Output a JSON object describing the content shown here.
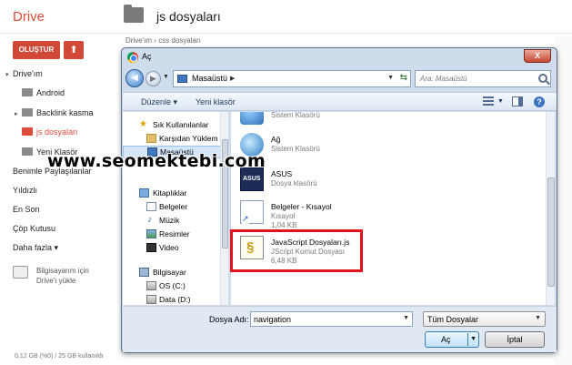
{
  "drive": {
    "logo": "Drive",
    "folder_title": "js dosyaları",
    "create_label": "OLUŞTUR",
    "upload_icon": "upload-icon",
    "breadcrumb": "Drive'ım  ›  css dosyaları",
    "nav": [
      {
        "label": "Drive'ım",
        "type": "root"
      },
      {
        "label": "Android",
        "type": "folder"
      },
      {
        "label": "Backlink kasma",
        "type": "folder-expandable"
      },
      {
        "label": "js dosyaları",
        "type": "folder-active"
      },
      {
        "label": "Yeni Klasör",
        "type": "folder"
      },
      {
        "label": "Benimle Paylaşılanlar",
        "type": "link"
      },
      {
        "label": "Yıldızlı",
        "type": "link"
      },
      {
        "label": "En Son",
        "type": "link"
      },
      {
        "label": "Çöp Kutusu",
        "type": "link"
      },
      {
        "label": "Daha fazla",
        "type": "link-dropdown"
      }
    ],
    "pc_sync_line1": "Bilgisayarım için",
    "pc_sync_line2": "Drive'ı yükle",
    "storage": "0,12 GB (%0) / 25 GB kullanıldı",
    "active_color": "#dd4b39"
  },
  "dialog": {
    "title": "Aç",
    "close_label": "X",
    "address": "Masaüstü",
    "search_placeholder": "Ara: Masaüstü",
    "toolbar": {
      "organize": "Düzenle",
      "new_folder": "Yeni klasör"
    },
    "sidebar": [
      {
        "label": "Sık Kullanılanlar",
        "icon": "star-icon"
      },
      {
        "label": "Karşıdan Yüklem",
        "icon": "folder-icon"
      },
      {
        "label": "Masaüstü",
        "icon": "desktop-icon",
        "selected": true
      },
      {
        "label": "Kitaplıklar",
        "icon": "library-icon"
      },
      {
        "label": "Belgeler",
        "icon": "document-icon"
      },
      {
        "label": "Müzik",
        "icon": "music-icon"
      },
      {
        "label": "Resimler",
        "icon": "picture-icon"
      },
      {
        "label": "Video",
        "icon": "video-icon"
      },
      {
        "label": "Bilgisayar",
        "icon": "computer-icon"
      },
      {
        "label": "OS (C:)",
        "icon": "drive-icon"
      },
      {
        "label": "Data (D:)",
        "icon": "drive-icon"
      }
    ],
    "files": [
      {
        "name": "",
        "type": "Sistem Klasörü",
        "size": "",
        "icon": "system-folder-icon"
      },
      {
        "name": "Ağ",
        "type": "Sistem Klasörü",
        "size": "",
        "icon": "network-icon"
      },
      {
        "name": "ASUS",
        "type": "Dosya klasörü",
        "size": "",
        "icon": "asus-folder-icon"
      },
      {
        "name": "Belgeler - Kısayol",
        "type": "Kısayol",
        "size": "1,04 KB",
        "icon": "shortcut-icon"
      },
      {
        "name": "JavaScript Dosyaları.js",
        "type": "JScript Komut Dosyası",
        "size": "6,48 KB",
        "icon": "jscript-file-icon"
      }
    ],
    "filename_label": "Dosya Adı:",
    "filename_value": "navigation",
    "filetype_value": "Tüm Dosyalar",
    "open_label": "Aç",
    "cancel_label": "İptal",
    "highlight_color": "#e0141e"
  },
  "watermark": "www.seomektebi.com"
}
